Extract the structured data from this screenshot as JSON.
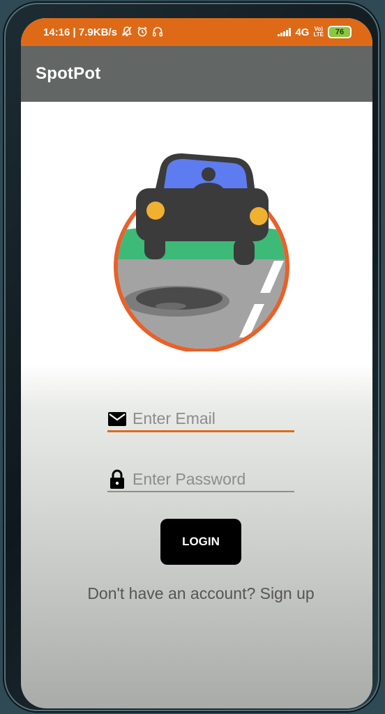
{
  "status_bar": {
    "time_speed": "14:16 | 7.9KB/s",
    "network": "4G",
    "volte_top": "Vo)",
    "volte_bottom": "LTE",
    "battery": "76",
    "icons": [
      "mute-icon",
      "alarm-icon",
      "headset-icon",
      "signal-icon"
    ],
    "background": "#de6a17"
  },
  "app_bar": {
    "title": "SpotPot",
    "background": "#626664"
  },
  "logo": {
    "icon": "car-pothole-logo",
    "ring_color": "#e8612a"
  },
  "login_form": {
    "email_placeholder": "Enter Email",
    "email_value": "",
    "password_placeholder": "Enter Password",
    "password_value": "",
    "login_label": "LOGIN",
    "signup_text": "Don't have an account? Sign up",
    "accent": "#de6a17"
  }
}
